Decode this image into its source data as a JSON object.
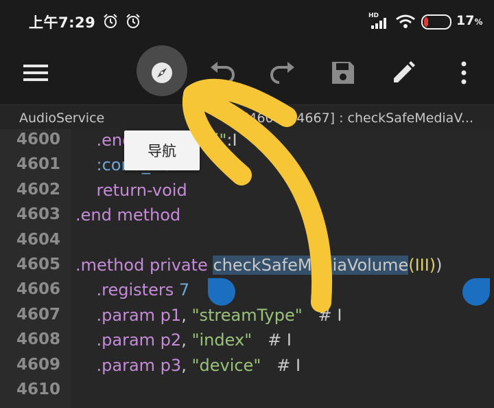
{
  "status_bar": {
    "time": "上午7:29",
    "network": "HD",
    "battery_percent": "17",
    "battery_unit": "%",
    "battery_level": 0.17,
    "icons": [
      "alarm-clock-icon",
      "alarm-icon",
      "signal-icon",
      "wifi-icon",
      "battery-icon"
    ]
  },
  "toolbar": {
    "buttons": [
      "menu-icon",
      "navigate-icon",
      "undo-icon",
      "redo-icon",
      "save-icon",
      "edit-icon",
      "more-vert-icon"
    ]
  },
  "header": {
    "class_name": "AudioService",
    "method_info": "[4600 – 4667] : checkSafeMediaV..."
  },
  "tooltip": {
    "text": "导航"
  },
  "editor": {
    "lines": [
      {
        "num": "4600",
        "parts": [
          [
            "kw",
            "    .end local "
          ],
          [
            "blue",
            "v0"
          ],
          [
            "plain",
            " "
          ],
          [
            "str",
            "\"i\""
          ],
          [
            "plain",
            ":I"
          ]
        ]
      },
      {
        "num": "4601",
        "parts": [
          [
            "blue",
            "    :cond_2b"
          ]
        ]
      },
      {
        "num": "4602",
        "parts": [
          [
            "kw",
            "    return-void"
          ]
        ]
      },
      {
        "num": "4603",
        "parts": [
          [
            "kw",
            ".end method"
          ]
        ]
      },
      {
        "num": "4604",
        "parts": []
      },
      {
        "num": "4605",
        "parts": [
          [
            "kw",
            ".method private "
          ],
          [
            "hl",
            "checkSafeMediaVolume"
          ],
          [
            "paren",
            "(III)"
          ],
          [
            "plain",
            ")"
          ]
        ]
      },
      {
        "num": "4606",
        "parts": [
          [
            "kw",
            "    .registers "
          ],
          [
            "blue",
            "7"
          ]
        ]
      },
      {
        "num": "4607",
        "parts": [
          [
            "kw",
            "    .param "
          ],
          [
            "kw",
            "p1"
          ],
          [
            "plain",
            ", "
          ],
          [
            "str",
            "\"streamType\""
          ],
          [
            "cmt",
            "   # I"
          ]
        ]
      },
      {
        "num": "4608",
        "parts": [
          [
            "kw",
            "    .param "
          ],
          [
            "kw",
            "p2"
          ],
          [
            "plain",
            ", "
          ],
          [
            "str",
            "\"index\""
          ],
          [
            "cmt",
            "   # I"
          ]
        ]
      },
      {
        "num": "4609",
        "parts": [
          [
            "kw",
            "    .param "
          ],
          [
            "kw",
            "p3"
          ],
          [
            "plain",
            ", "
          ],
          [
            "str",
            "\"device\""
          ],
          [
            "cmt",
            "   # I"
          ]
        ]
      },
      {
        "num": "4610",
        "parts": []
      }
    ]
  },
  "colors": {
    "arrow": "#f6c637",
    "selection": "#34506b",
    "handle": "#1c6fc0",
    "keyword": "#c58bd8",
    "string": "#9ac27a"
  }
}
